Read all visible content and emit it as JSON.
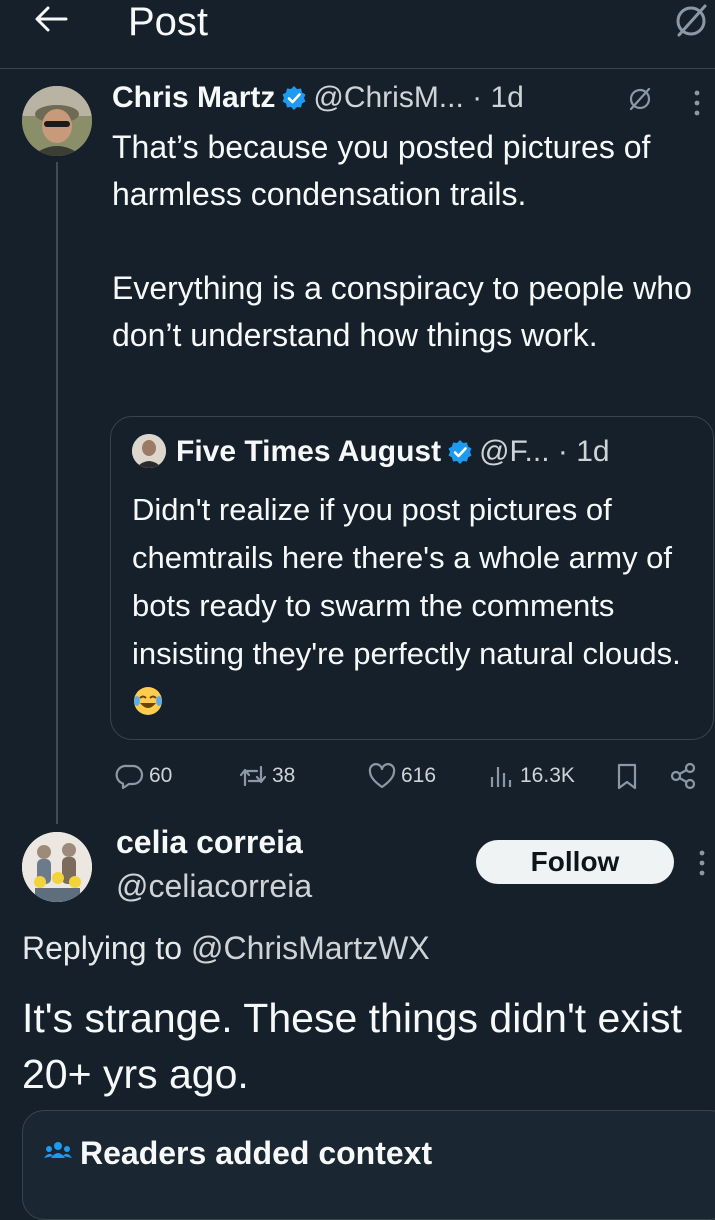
{
  "header": {
    "title": "Post",
    "back_icon": "arrow-left-icon",
    "right_icon": "grok-slash-icon"
  },
  "tweet": {
    "display_name": "Chris Martz",
    "handle": "@ChrisM...",
    "time": "· 1d",
    "verified": true,
    "body": "That’s because you posted pictures of harmless condensation trails.\n\nEverything is a conspiracy to people who don’t understand how things work.",
    "quote": {
      "display_name": "Five Times August",
      "handle": "@F...",
      "time": "· 1d",
      "verified": true,
      "body": "Didn't realize if you post pictures of chemtrails here there's a whole army of bots ready to swarm the comments insisting they're perfectly natural clouds. "
    },
    "stats": {
      "replies": "60",
      "reposts": "38",
      "likes": "616",
      "views": "16.3K"
    }
  },
  "reply": {
    "display_name": "celia correia",
    "handle": "@celiacorreia",
    "follow_label": "Follow",
    "replying_label": "Replying to",
    "replying_handle": "@ChrisMartzWX",
    "body": "It's strange. These things didn't exist 20+ yrs ago."
  },
  "context_note": {
    "title": "Readers added context"
  },
  "colors": {
    "background": "#15202b",
    "verified": "#1d9bf0",
    "muted": "#cfd3d6",
    "border": "#38444d"
  }
}
